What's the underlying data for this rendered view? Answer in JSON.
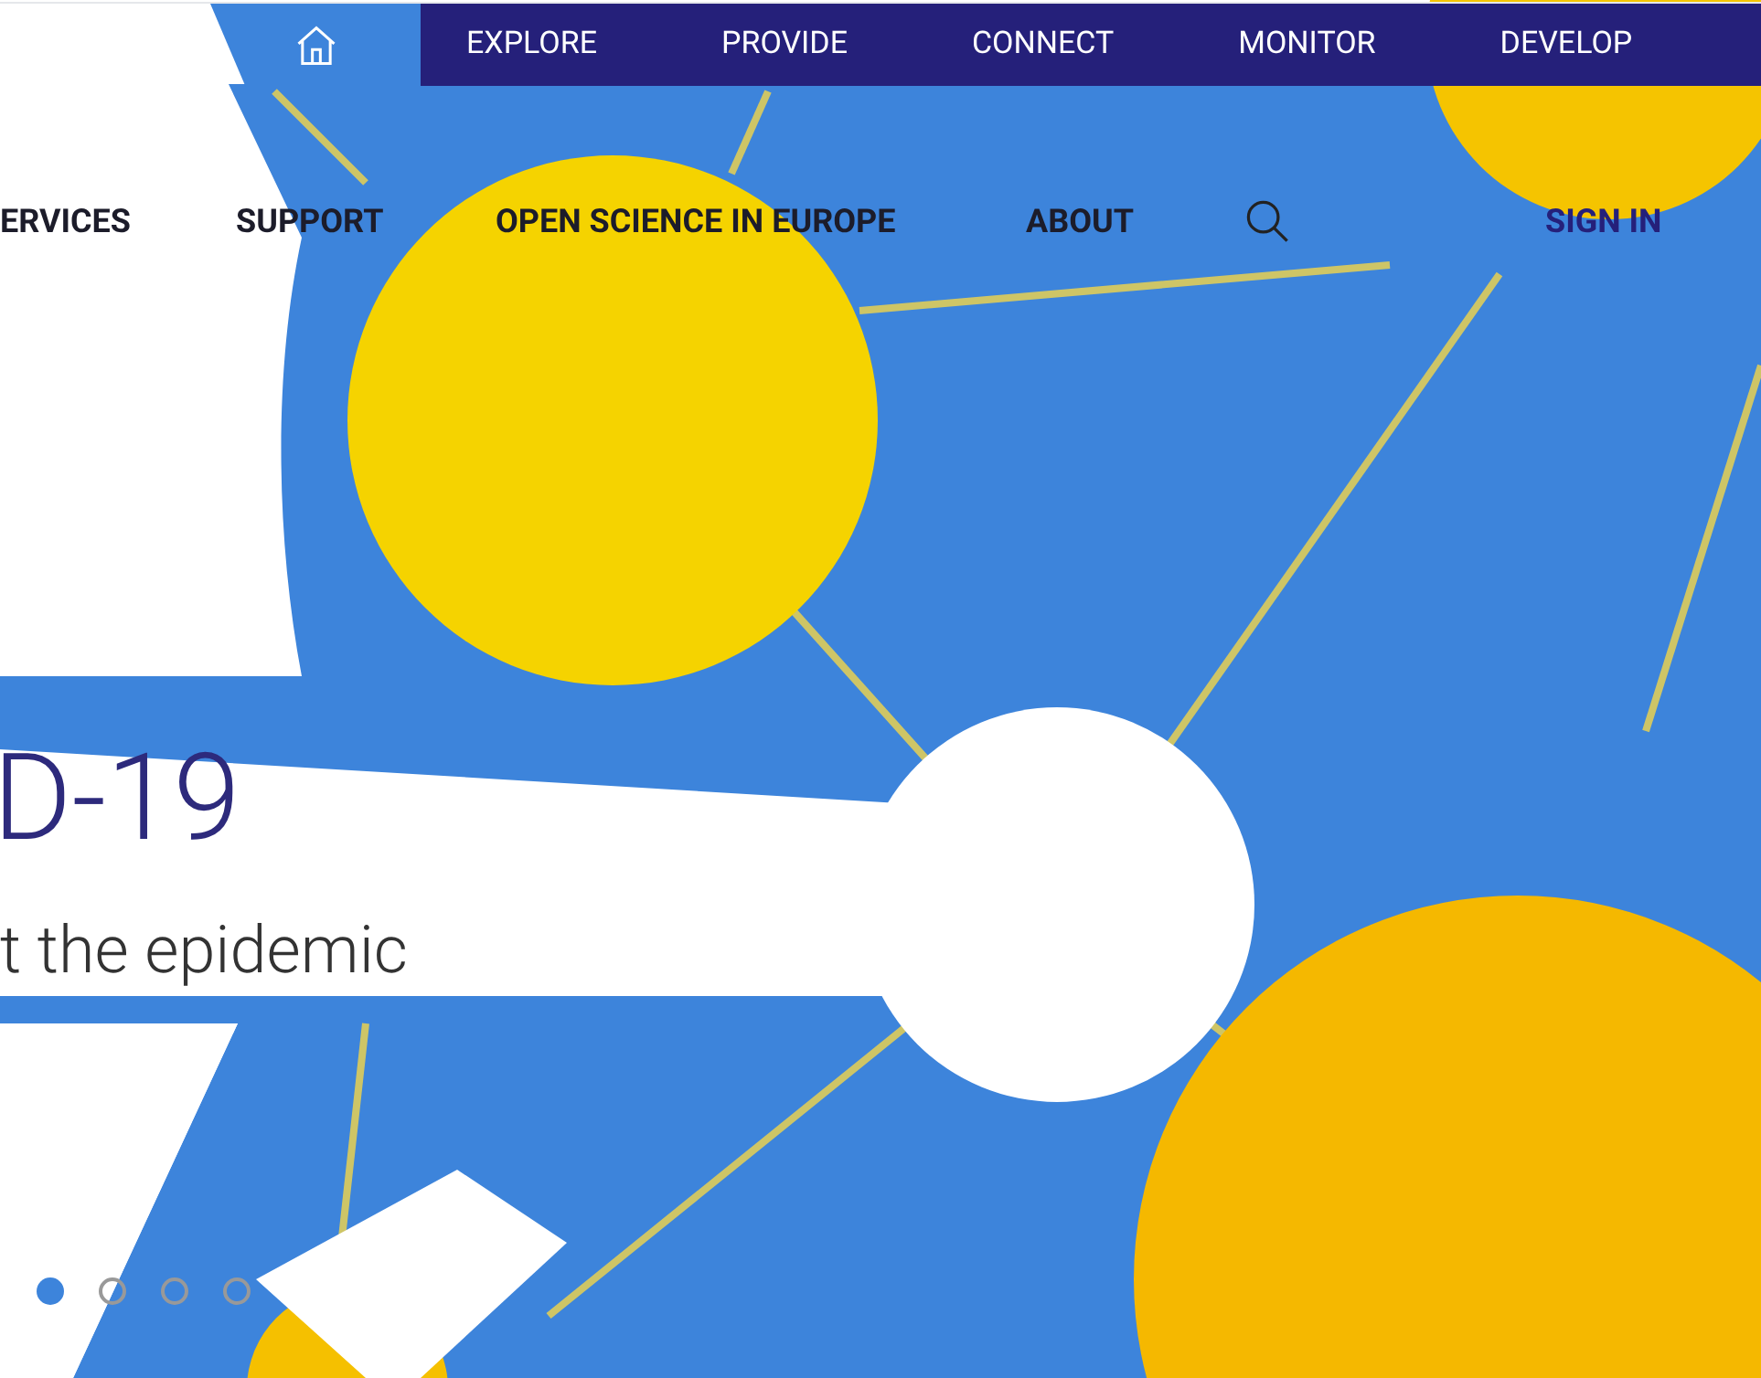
{
  "top_nav": {
    "items": [
      {
        "label": "EXPLORE"
      },
      {
        "label": "PROVIDE"
      },
      {
        "label": "CONNECT"
      },
      {
        "label": "MONITOR"
      },
      {
        "label": "DEVELOP"
      }
    ]
  },
  "main_nav": {
    "items": [
      {
        "label": "ERVICES"
      },
      {
        "label": "SUPPORT"
      },
      {
        "label": "OPEN SCIENCE IN EUROPE"
      },
      {
        "label": "ABOUT"
      }
    ],
    "sign_in": "SIGN IN"
  },
  "hero": {
    "title": "D-19",
    "subtitle": "t the epidemic"
  },
  "slides": [
    {
      "selected": true
    },
    {
      "selected": false
    },
    {
      "selected": false
    },
    {
      "selected": false
    }
  ]
}
